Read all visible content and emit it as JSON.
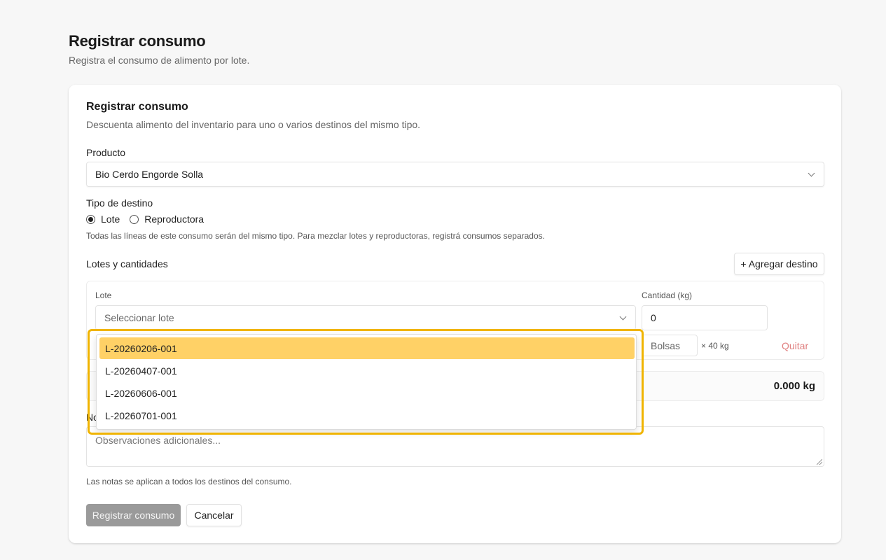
{
  "header": {
    "title": "Registrar consumo",
    "subtitle": "Registra el consumo de alimento por lote."
  },
  "card": {
    "title": "Registrar consumo",
    "description": "Descuenta alimento del inventario para uno o varios destinos del mismo tipo."
  },
  "producto": {
    "label": "Producto",
    "value": "Bio Cerdo Engorde Solla"
  },
  "tipo_destino": {
    "label": "Tipo de destino",
    "options": [
      "Lote",
      "Reproductora"
    ],
    "selected": "Lote",
    "hint": "Todas las líneas de este consumo serán del mismo tipo. Para mezclar lotes y reproductoras, registrá consumos separados."
  },
  "lotes": {
    "label": "Lotes y cantidades",
    "add_button": "+ Agregar destino",
    "line": {
      "lote_label": "Lote",
      "lote_placeholder": "Seleccionar lote",
      "cantidad_label": "Cantidad (kg)",
      "cantidad_value": "0",
      "bolsas_placeholder": "Bolsas",
      "bolsas_unit": "× 40 kg",
      "remove_label": "Quitar"
    },
    "total": "0.000 kg"
  },
  "dropdown": {
    "options": [
      "L-20260206-001",
      "L-20260407-001",
      "L-20260606-001",
      "L-20260701-001"
    ],
    "highlighted": "L-20260206-001"
  },
  "notas": {
    "label": "Notas",
    "placeholder": "Observaciones adicionales...",
    "hint": "Las notas se aplican a todos los destinos del consumo."
  },
  "actions": {
    "submit": "Registrar consumo",
    "cancel": "Cancelar"
  },
  "colors": {
    "highlight": "#ffd166",
    "ring": "#f0b400",
    "remove": "#e08080",
    "primary_disabled": "#9a9a9a"
  }
}
